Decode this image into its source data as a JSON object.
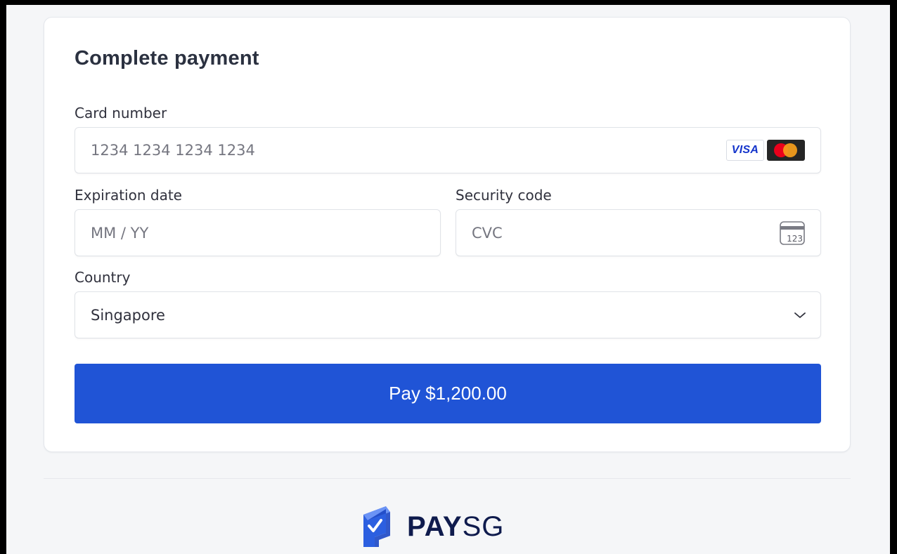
{
  "form": {
    "title": "Complete payment",
    "card_number": {
      "label": "Card number",
      "placeholder": "1234 1234 1234 1234",
      "brands": [
        "visa-icon",
        "mastercard-icon"
      ],
      "visa_text": "VISA"
    },
    "expiration": {
      "label": "Expiration date",
      "placeholder": "MM / YY"
    },
    "security_code": {
      "label": "Security code",
      "placeholder": "CVC",
      "icon_text": "123"
    },
    "country": {
      "label": "Country",
      "value": "Singapore"
    },
    "pay_button_label": "Pay $1,200.00"
  },
  "footer": {
    "logo_text_bold": "PAY",
    "logo_text_regular": "SG"
  },
  "colors": {
    "accent": "#2054d6",
    "brand_navy": "#0f1b4d",
    "logo_blue": "#3a6ff0"
  }
}
